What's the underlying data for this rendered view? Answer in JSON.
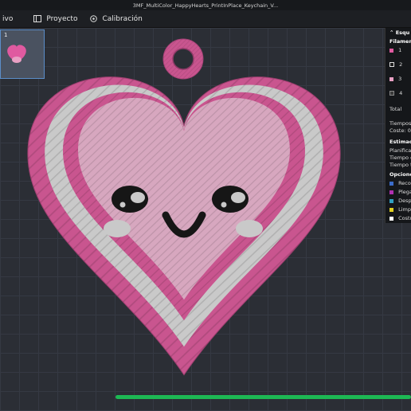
{
  "window": {
    "title": "3MF_MultiColor_HappyHearts_PrintInPlace_Keychain_V..."
  },
  "menu": {
    "archive": "ivo",
    "project": "Proyecto",
    "calibration": "Calibración"
  },
  "plate": {
    "number": "1"
  },
  "panel": {
    "header": "Esqu",
    "filaments_label": "Filamento",
    "filaments": [
      {
        "label": "1",
        "color": "#e05aa0"
      },
      {
        "label": "2",
        "color": "#1a1a1a"
      },
      {
        "label": "3",
        "color": "#e9a0c4"
      },
      {
        "label": "4",
        "color": "#3a3a3a"
      }
    ],
    "total": "Total",
    "times": "Tiempos e",
    "cost": "Coste:  0.",
    "estimation": "Estimació",
    "plan": "Planificar",
    "time1": "Tiempo d",
    "time_total": "Tiempo to",
    "options": "Opciones",
    "option_items": [
      {
        "label": "Recorri",
        "color": "#3b6cc9"
      },
      {
        "label": "Plegar",
        "color": "#b030b0"
      },
      {
        "label": "Despley",
        "color": "#30a0c0"
      },
      {
        "label": "Limpiar",
        "color": "#e0d020"
      },
      {
        "label": "Costur",
        "color": "#ffffff"
      }
    ]
  },
  "colors": {
    "pink": "#c9558f",
    "light_pink": "#d7a7bf",
    "white": "#c9c9c9",
    "dark": "#161616",
    "progress": "#1db954"
  }
}
